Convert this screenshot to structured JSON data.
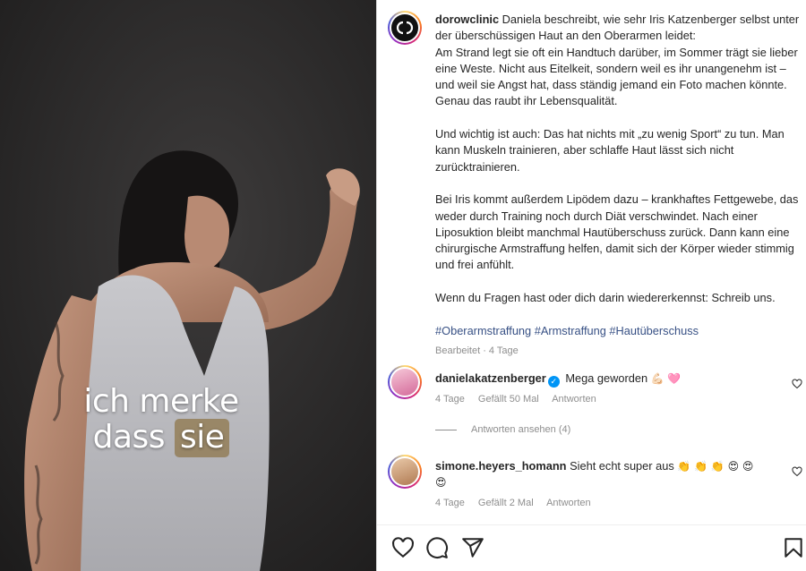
{
  "media": {
    "caption_line1": "ich merke",
    "caption_line2_a": "dass ",
    "caption_line2_b": "sie"
  },
  "post": {
    "author_avatar": "dc-logo-avatar",
    "author": "dorowclinic",
    "caption_intro": "Daniela beschreibt, wie sehr Iris Katzenberger selbst unter der überschüssigen Haut an den Oberarmen leidet:",
    "caption_p1": "Am Strand legt sie oft ein Handtuch darüber, im Sommer trägt sie lieber eine Weste. Nicht aus Eitelkeit, sondern weil es ihr unangenehm ist – und weil sie Angst hat, dass ständig jemand ein Foto machen könnte. Genau das raubt ihr Lebensqualität.",
    "caption_p2": "Und wichtig ist auch: Das hat nichts mit „zu wenig Sport“ zu tun. Man kann Muskeln trainieren, aber schlaffe Haut lässt sich nicht zurücktrainieren.",
    "caption_p3": "Bei Iris kommt außerdem Lipödem dazu – krankhaftes Fettgewebe, das weder durch Training noch durch Diät verschwindet. Nach einer Liposuktion bleibt manchmal Hautüberschuss zurück. Dann kann eine chirurgische Armstraffung helfen, damit sich der Körper wieder stimmig und frei anfühlt.",
    "caption_p4": "Wenn du Fragen hast oder dich darin wiedererkennst: Schreib uns.",
    "hashtags": "#Oberarmstraffung #Armstraffung #Hautüberschuss",
    "edited": "Bearbeitet · 4 Tage"
  },
  "comments": [
    {
      "user": "danielakatzenberger",
      "verified": true,
      "text": "Mega geworden",
      "emojis": "💪🏻 🩷",
      "age": "4 Tage",
      "likes": "Gefällt 50 Mal",
      "reply": "Antworten"
    },
    {
      "user": "simone.heyers_homann",
      "verified": false,
      "text": "Sieht echt super aus",
      "emojis": "👏 👏 👏 😍 😍",
      "emojis2": "😍",
      "age": "4 Tage",
      "likes": "Gefällt 2 Mal",
      "reply": "Antworten"
    }
  ],
  "view_replies": "Antworten ansehen (4)",
  "colors": {
    "verified": "#0095f6",
    "hashtag": "#385185",
    "muted": "#8e8e8e"
  },
  "icons": [
    "heart-icon",
    "comment-icon",
    "share-icon",
    "bookmark-icon",
    "verified-badge-icon"
  ]
}
